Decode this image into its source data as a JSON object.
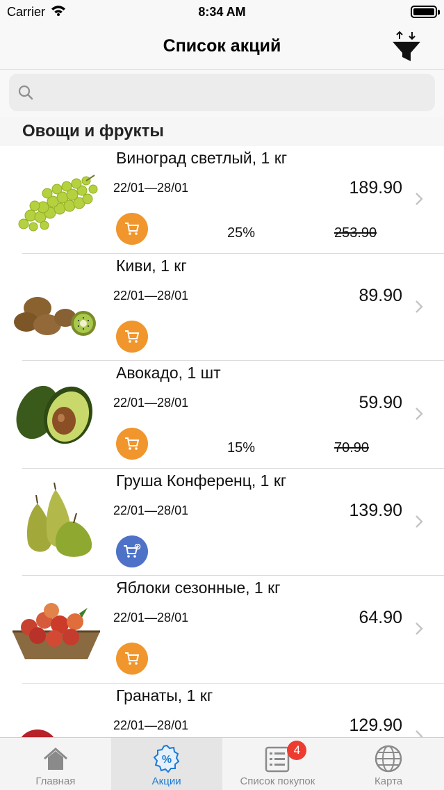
{
  "status_bar": {
    "carrier": "Carrier",
    "time": "8:34 AM"
  },
  "nav": {
    "title": "Список акций"
  },
  "search": {
    "placeholder": "",
    "value": ""
  },
  "section": {
    "title": "Овощи и фрукты"
  },
  "items": [
    {
      "name": "Виноград светлый, 1 кг",
      "dates": "22/01—28/01",
      "price": "189.90",
      "discount": "25%",
      "old_price": "253.90",
      "cart": "orange",
      "image": "grapes"
    },
    {
      "name": "Киви, 1 кг",
      "dates": "22/01—28/01",
      "price": "89.90",
      "discount": "",
      "old_price": "",
      "cart": "orange",
      "image": "kiwi"
    },
    {
      "name": "Авокадо, 1 шт",
      "dates": "22/01—28/01",
      "price": "59.90",
      "discount": "15%",
      "old_price": "70.90",
      "cart": "orange",
      "image": "avocado"
    },
    {
      "name": "Груша Конференц, 1 кг",
      "dates": "22/01—28/01",
      "price": "139.90",
      "discount": "",
      "old_price": "",
      "cart": "blue",
      "image": "pears"
    },
    {
      "name": "Яблоки сезонные, 1 кг",
      "dates": "22/01—28/01",
      "price": "64.90",
      "discount": "",
      "old_price": "",
      "cart": "orange",
      "image": "apples"
    },
    {
      "name": "Гранаты, 1 кг",
      "dates": "22/01—28/01",
      "price": "129.90",
      "discount": "",
      "old_price": "",
      "cart": "orange",
      "image": "pomegranate"
    }
  ],
  "tabs": [
    {
      "label": "Главная",
      "icon": "home-icon",
      "active": false
    },
    {
      "label": "Акции",
      "icon": "percent-badge-icon",
      "active": true
    },
    {
      "label": "Список покупок",
      "icon": "shopping-list-icon",
      "active": false,
      "badge": "4"
    },
    {
      "label": "Карта",
      "icon": "globe-icon",
      "active": false
    }
  ],
  "colors": {
    "accent": "#1a7ad6",
    "cart_orange": "#f0962c",
    "cart_blue": "#4d72c8",
    "badge_red": "#ee3b30"
  }
}
